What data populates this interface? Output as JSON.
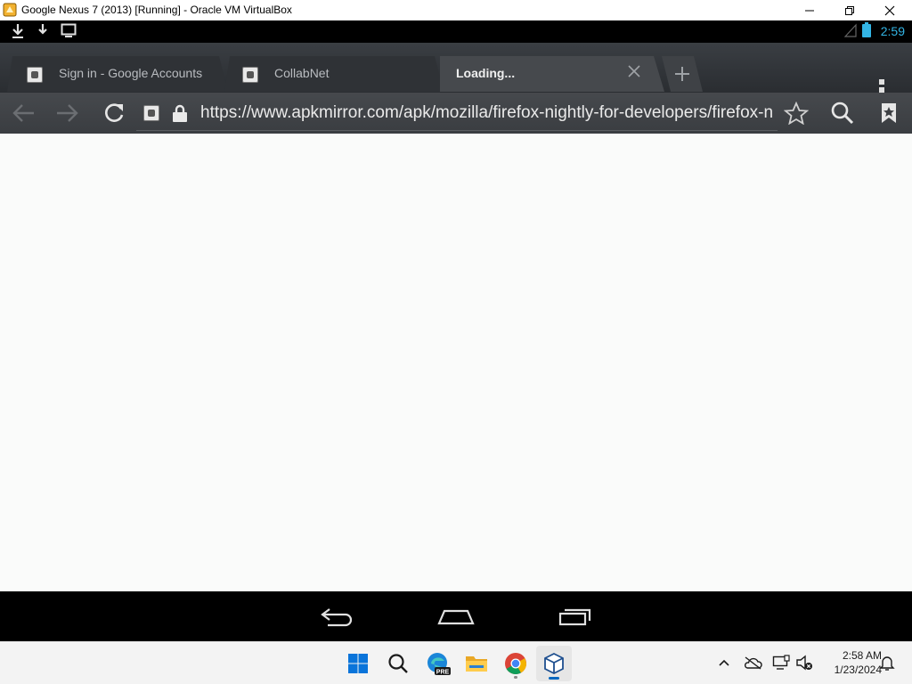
{
  "window": {
    "title": "Google Nexus 7 (2013) [Running] - Oracle VM VirtualBox",
    "controls": [
      "minimize",
      "restore",
      "close"
    ]
  },
  "android": {
    "status_bar": {
      "left_icons": [
        "download-icon",
        "download-icon",
        "screen-icon"
      ],
      "time": "2:59",
      "time_color": "#33b5e5"
    },
    "tabs": [
      {
        "label": "Sign in - Google Accounts",
        "active": false
      },
      {
        "label": "CollabNet",
        "active": false
      },
      {
        "label": "Loading...",
        "active": true
      }
    ],
    "url_bar": {
      "url": "https://www.apkmirror.com/apk/mozilla/firefox-nightly-for-developers/firefox-nightly-for-developers-release/"
    },
    "nav_keys": [
      "back-icon",
      "home-icon",
      "recents-icon"
    ]
  },
  "taskbar": {
    "apps": [
      "windows-start-icon",
      "search-icon",
      "edge-pre-icon",
      "file-explorer-icon",
      "chrome-icon",
      "virtualbox-icon"
    ],
    "edge_badge": "PRE",
    "clock_time": "2:58 AM",
    "clock_date": "1/23/2024",
    "accent": "#0067c0"
  }
}
